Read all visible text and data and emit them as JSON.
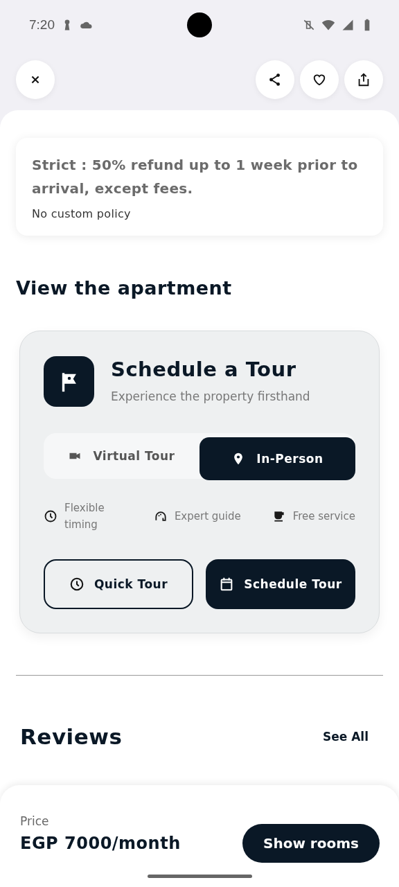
{
  "status_bar": {
    "time": "7:20"
  },
  "header": {
    "actions": [
      {
        "kind": "share"
      },
      {
        "kind": "favorite",
        "selected": false
      },
      {
        "kind": "export"
      }
    ]
  },
  "policy": {
    "title": "Strict : 50% refund up to 1 week prior to arrival, except fees.",
    "note": "No custom policy"
  },
  "section_title": "View the apartment",
  "tour": {
    "title": "Schedule a Tour",
    "subtitle": "Experience the property firsthand",
    "tabs": [
      {
        "kind": "video",
        "label": "Virtual Tour",
        "selected": false
      },
      {
        "kind": "pin",
        "label": "In-Person",
        "selected": true
      }
    ],
    "features": [
      {
        "kind": "clock",
        "label": "Flexible timing"
      },
      {
        "kind": "guide",
        "label": "Expert guide"
      },
      {
        "kind": "cup",
        "label": "Free service"
      }
    ],
    "buttons": [
      {
        "kind": "clock",
        "label": "Quick Tour",
        "primary": false
      },
      {
        "kind": "calendar",
        "label": "Schedule Tour",
        "primary": true
      }
    ]
  },
  "reviews": {
    "title": "Reviews",
    "link": "See All"
  },
  "footer": {
    "price_label": "Price",
    "price": "EGP 7000/month",
    "button": "Show rooms"
  }
}
